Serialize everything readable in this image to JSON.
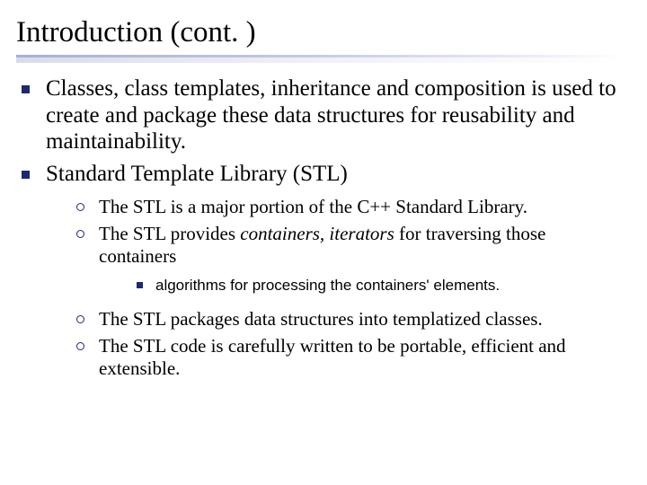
{
  "title": "Introduction (cont. )",
  "bullets": {
    "b1": "Classes, class templates, inheritance and composition is used to create and package these data structures for reusability and maintainability.",
    "b2": "Standard Template Library (STL)",
    "b2_1": "The STL is a major portion of the C++ Standard Library.",
    "b2_2_pre": "The STL provides ",
    "b2_2_em": "containers, iterators",
    "b2_2_post": " for traversing those containers",
    "b2_2_a": "algorithms for processing the containers' elements.",
    "b2_3": "The STL packages data structures into templatized classes.",
    "b2_4": "The STL code is carefully written to be portable, efficient and extensible."
  },
  "colors": {
    "accent": "#1e2a6b"
  }
}
